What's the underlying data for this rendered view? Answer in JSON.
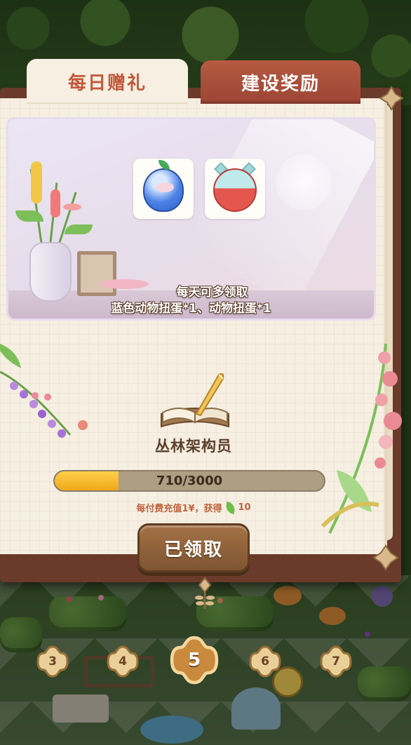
{
  "tabs": [
    {
      "label": "每日赠礼",
      "active": true
    },
    {
      "label": "建设奖励",
      "active": false
    }
  ],
  "daily_gift": {
    "items": [
      {
        "name": "blue-animal-gacha-egg-icon"
      },
      {
        "name": "animal-gacha-egg-icon"
      }
    ],
    "description_line1": "每天可多领取",
    "description_line2": "蓝色动物扭蛋*1、动物扭蛋*1"
  },
  "achievement": {
    "title": "丛林架构员",
    "progress_text": "710/3000",
    "progress_fraction": 0.2367,
    "recharge_prefix": "每付费充值1¥，获得",
    "reward_amount": "10",
    "reward_icon": "leaf-icon"
  },
  "claim_button": {
    "label": "已领取"
  },
  "levels": [
    {
      "number": "3",
      "current": false
    },
    {
      "number": "4",
      "current": false
    },
    {
      "number": "5",
      "current": true
    },
    {
      "number": "6",
      "current": false
    },
    {
      "number": "7",
      "current": false
    }
  ],
  "colors": {
    "tab_active_text": "#c2593a",
    "tab_inactive_bg": "#b55a42",
    "panel_bg": "#f6efe2",
    "progress_fill": "#f0a81a",
    "button_bg": "#7e5431",
    "recharge_text": "#c0623d"
  }
}
